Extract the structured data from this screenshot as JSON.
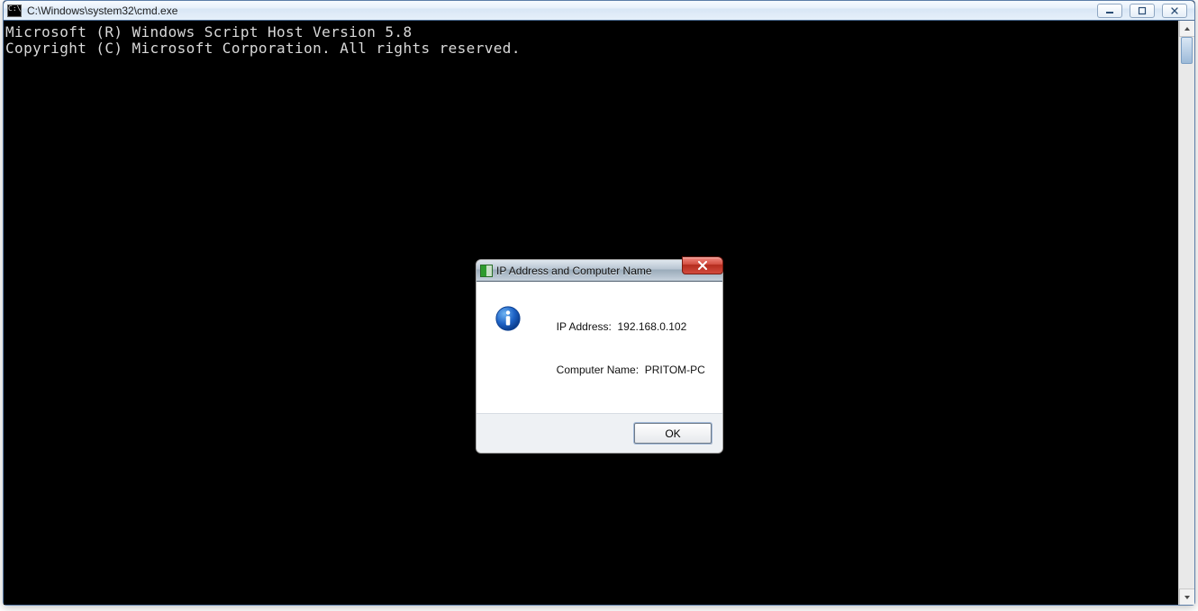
{
  "cmd": {
    "title": "C:\\Windows\\system32\\cmd.exe",
    "lines": [
      "Microsoft (R) Windows Script Host Version 5.8",
      "Copyright (C) Microsoft Corporation. All rights reserved."
    ],
    "buttons": {
      "min": "—",
      "max": "▢",
      "close": "✕"
    }
  },
  "dialog": {
    "title": "IP Address and Computer Name",
    "close": "✕",
    "ip_label": "IP Address:",
    "ip_value": "192.168.0.102",
    "name_label": "Computer Name:",
    "name_value": "PRITOM-PC",
    "ok": "OK"
  }
}
